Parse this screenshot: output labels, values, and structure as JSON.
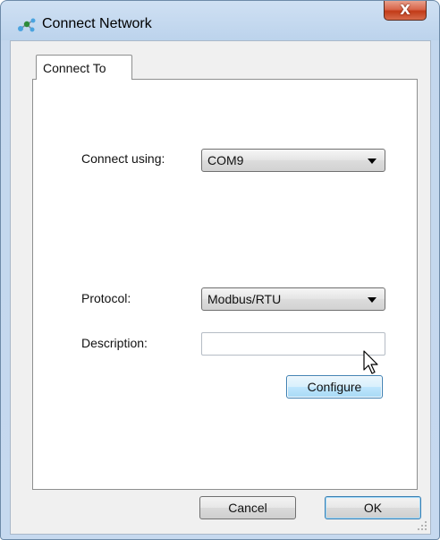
{
  "window": {
    "title": "Connect Network",
    "close_glyph": "X"
  },
  "tabs": [
    {
      "label": "Connect To",
      "selected": true
    }
  ],
  "form": {
    "connect_using": {
      "label": "Connect using:",
      "value": "COM9"
    },
    "protocol": {
      "label": "Protocol:",
      "value": "Modbus/RTU"
    },
    "description": {
      "label": "Description:",
      "value": ""
    },
    "configure_label": "Configure"
  },
  "footer": {
    "cancel_label": "Cancel",
    "ok_label": "OK"
  },
  "icons": {
    "app": "network-icon",
    "combo_arrow": "chevron-down-icon",
    "cursor": "mouse-pointer-icon",
    "grip": "resize-grip-icon"
  }
}
